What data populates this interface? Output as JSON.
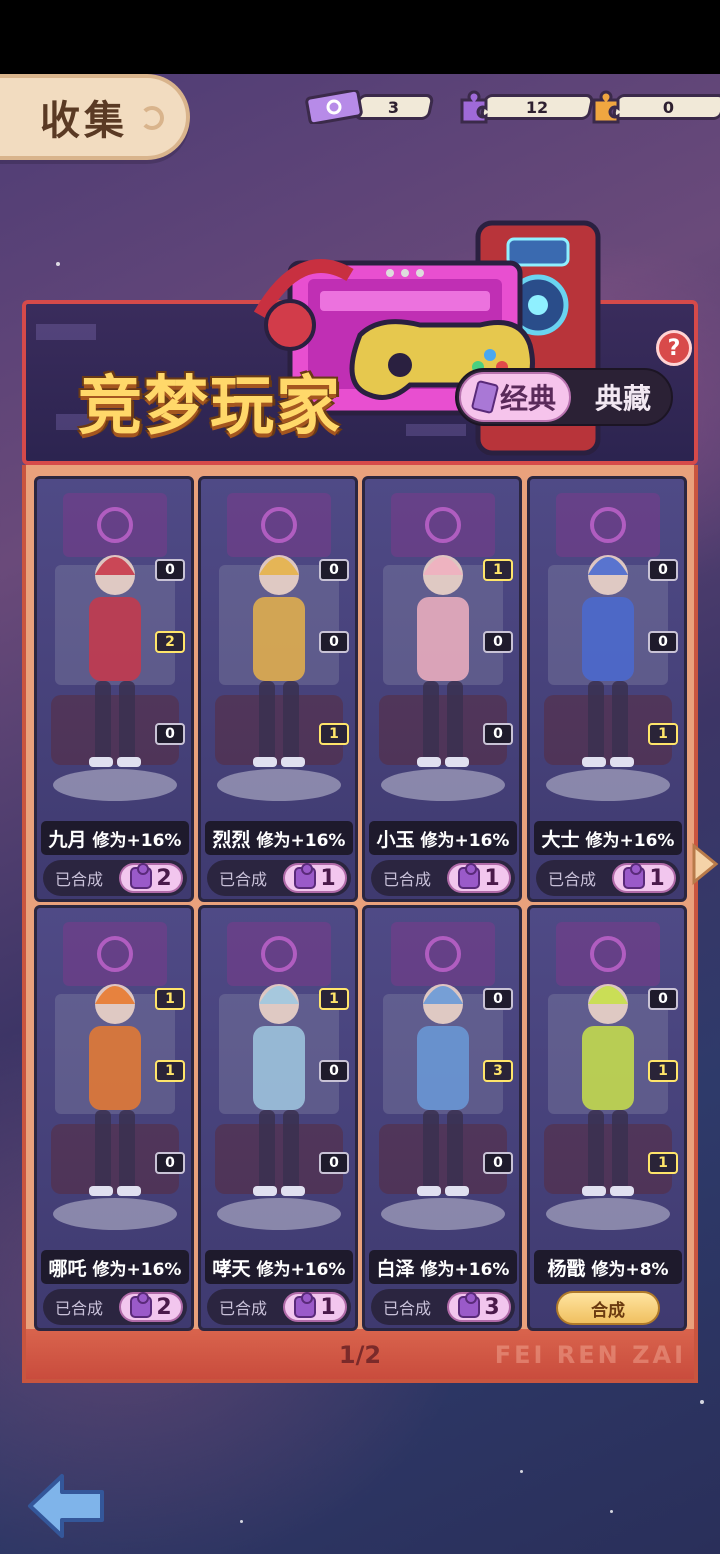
{
  "header": {
    "title": "收集"
  },
  "resources": [
    {
      "icon": "ticket-icon",
      "value": "3"
    },
    {
      "icon": "purple-puzzle-icon",
      "value": "12"
    },
    {
      "icon": "orange-puzzle-icon",
      "value": "0"
    }
  ],
  "banner": {
    "title": "竞梦玩家",
    "tab_classic": "经典",
    "tab_collect": "典藏",
    "help": "?"
  },
  "cards": [
    {
      "name": "九月",
      "bonus": "修为+16%",
      "status": "已合成",
      "count": "2",
      "fragments": [
        "0",
        "2",
        "0"
      ],
      "frag_on": [
        false,
        true,
        false
      ]
    },
    {
      "name": "烈烈",
      "bonus": "修为+16%",
      "status": "已合成",
      "count": "1",
      "fragments": [
        "0",
        "0",
        "1"
      ],
      "frag_on": [
        false,
        false,
        true
      ]
    },
    {
      "name": "小玉",
      "bonus": "修为+16%",
      "status": "已合成",
      "count": "1",
      "fragments": [
        "1",
        "0",
        "0"
      ],
      "frag_on": [
        true,
        false,
        false
      ]
    },
    {
      "name": "大士",
      "bonus": "修为+16%",
      "status": "已合成",
      "count": "1",
      "fragments": [
        "0",
        "0",
        "1"
      ],
      "frag_on": [
        false,
        false,
        true
      ]
    },
    {
      "name": "哪吒",
      "bonus": "修为+16%",
      "status": "已合成",
      "count": "2",
      "fragments": [
        "1",
        "1",
        "0"
      ],
      "frag_on": [
        true,
        true,
        false
      ]
    },
    {
      "name": "哮天",
      "bonus": "修为+16%",
      "status": "已合成",
      "count": "1",
      "fragments": [
        "1",
        "0",
        "0"
      ],
      "frag_on": [
        true,
        false,
        false
      ]
    },
    {
      "name": "白泽",
      "bonus": "修为+16%",
      "status": "已合成",
      "count": "3",
      "fragments": [
        "0",
        "3",
        "0"
      ],
      "frag_on": [
        false,
        true,
        false
      ]
    },
    {
      "name": "杨戬",
      "bonus": "修为+8%",
      "status": "",
      "count": "",
      "synth_button": "合成",
      "fragments": [
        "0",
        "1",
        "1"
      ],
      "frag_on": [
        false,
        true,
        true
      ]
    }
  ],
  "pager": "1/2",
  "watermark": "FEI REN ZAI"
}
